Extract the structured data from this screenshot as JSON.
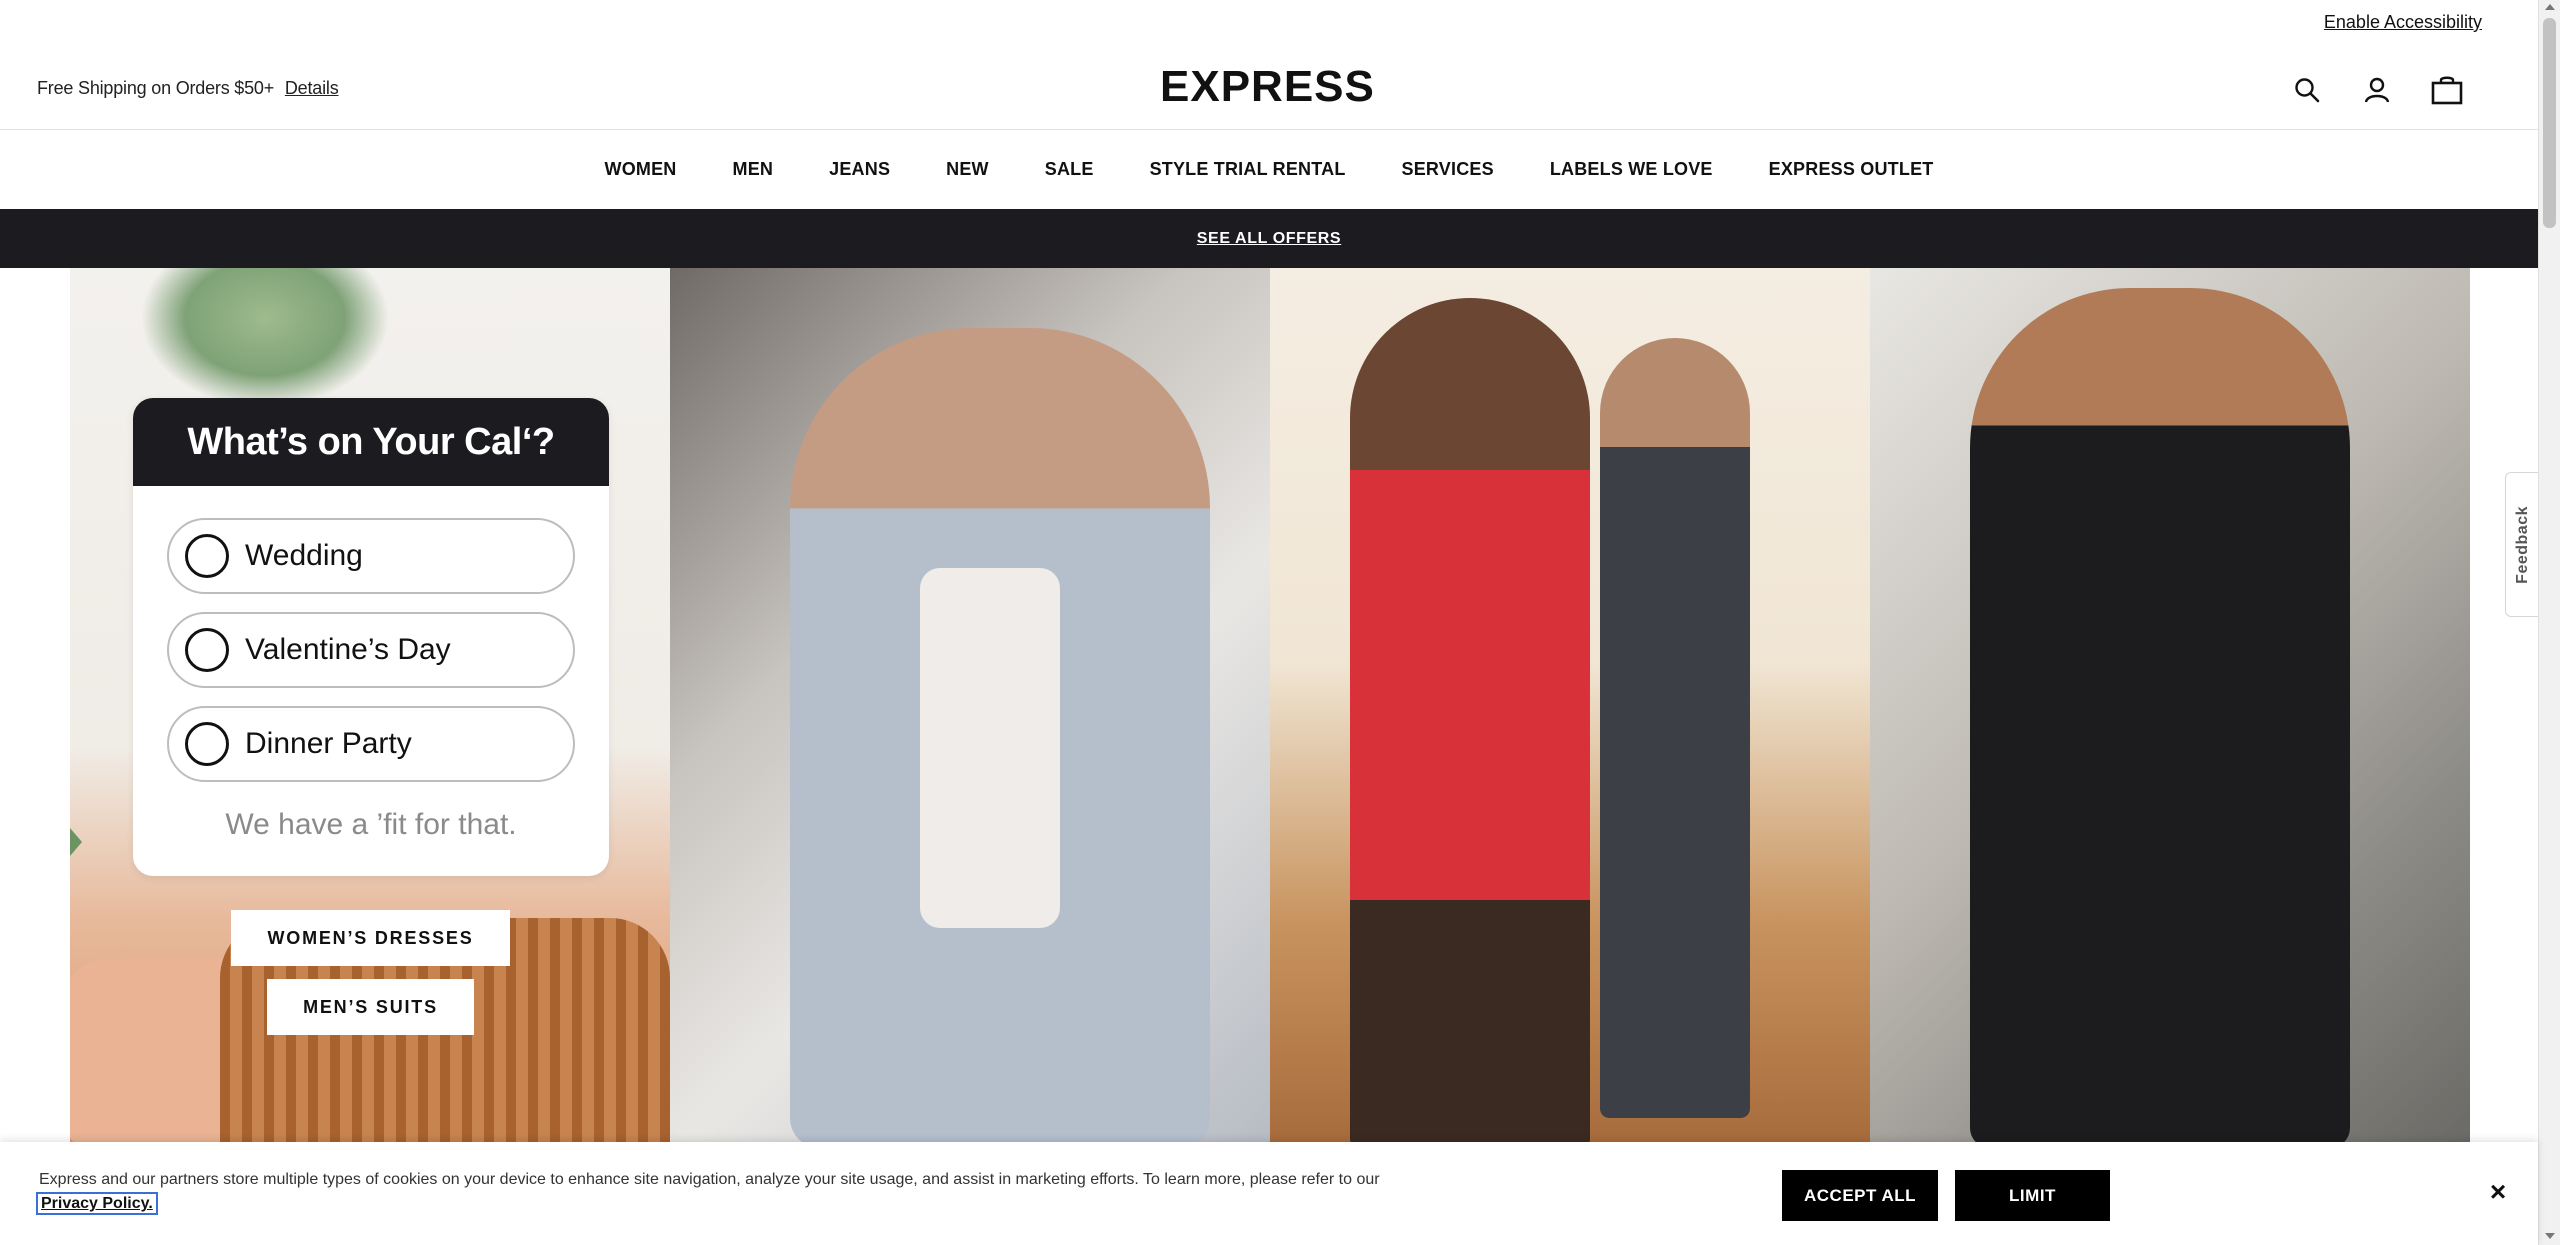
{
  "header": {
    "accessibility_link": "Enable Accessibility",
    "shipping_text": "Free Shipping on Orders $50+",
    "shipping_details": "Details",
    "logo": "EXPRESS",
    "icons": [
      "search-icon",
      "account-icon",
      "bag-icon"
    ]
  },
  "nav": {
    "items": [
      {
        "label": "WOMEN"
      },
      {
        "label": "MEN"
      },
      {
        "label": "JEANS"
      },
      {
        "label": "NEW"
      },
      {
        "label": "SALE"
      },
      {
        "label": "STYLE TRIAL RENTAL"
      },
      {
        "label": "SERVICES"
      },
      {
        "label": "LABELS WE LOVE"
      },
      {
        "label": "EXPRESS OUTLET"
      }
    ]
  },
  "offers_bar": {
    "label": "SEE ALL OFFERS"
  },
  "hero": {
    "card_title": "What’s on Your Cal‘?",
    "options": [
      {
        "label": "Wedding"
      },
      {
        "label": "Valentine’s Day"
      },
      {
        "label": "Dinner Party"
      }
    ],
    "tagline": "We have a ’fit for that.",
    "cta_primary": "WOMEN’S DRESSES",
    "cta_secondary": "MEN’S SUITS"
  },
  "feedback_tab": {
    "label": "Feedback"
  },
  "cookie_banner": {
    "text": "Express and our partners store multiple types of cookies on your device to enhance site navigation, analyze your site usage, and assist in marketing efforts. To learn more, please refer to our",
    "privacy_link": "Privacy Policy.",
    "accept_label": "ACCEPT ALL",
    "limit_label": "LIMIT",
    "close_label": "×"
  }
}
